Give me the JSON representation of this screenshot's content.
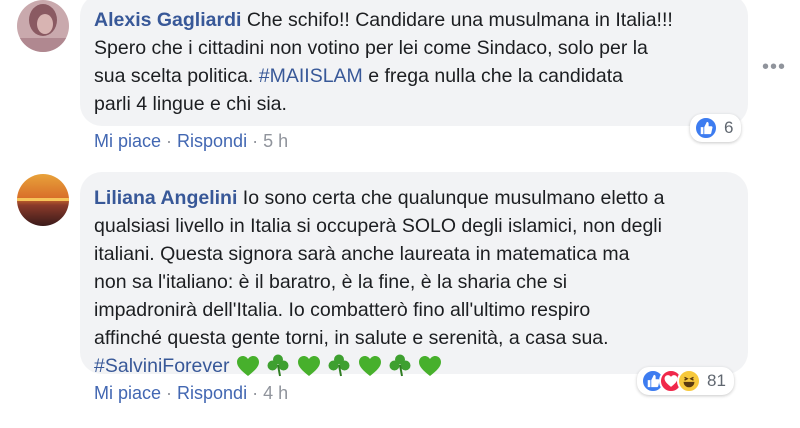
{
  "comments": [
    {
      "author": "Alexis Gagliardi",
      "lines": [
        "Che schifo!! Candidare una musulmana in Italia!!!",
        "Spero che i cittadini non votino per lei come Sindaco, solo per la",
        "sua scelta politica.",
        "e frega nulla che la candidata",
        "parli 4 lingue e chi sia."
      ],
      "hashtag": "#MAIISLAM",
      "actions": {
        "like": "Mi piace",
        "reply": "Rispondi",
        "time": "5 h"
      },
      "reaction_count": "6",
      "reactions": [
        "like"
      ]
    },
    {
      "author": "Liliana Angelini",
      "lines": [
        "Io sono certa che qualunque musulmano eletto a",
        "qualsiasi livello in Italia si occuperà SOLO degli islamici, non degli",
        "italiani. Questa signora sarà anche laureata in matematica ma",
        "non sa l'italiano: è il baratro, è la fine, è la sharia che si",
        "impadronirà dell'Italia. Io combatterò fino all'ultimo respiro",
        "affinché questa gente torni, in salute e serenità, a casa sua."
      ],
      "hashtag": "#SalviniForever",
      "emojis": [
        "green-heart",
        "shamrock",
        "green-heart",
        "shamrock",
        "green-heart",
        "shamrock",
        "green-heart"
      ],
      "actions": {
        "like": "Mi piace",
        "reply": "Rispondi",
        "time": "4 h"
      },
      "reaction_count": "81",
      "reactions": [
        "like",
        "haha",
        "love"
      ]
    }
  ],
  "ui": {
    "separator": "·",
    "more_icon": "more-options-icon",
    "colors": {
      "link": "#385898",
      "bubble": "#f2f3f5",
      "meta": "#90949c",
      "like": "#3d7cf0"
    }
  }
}
